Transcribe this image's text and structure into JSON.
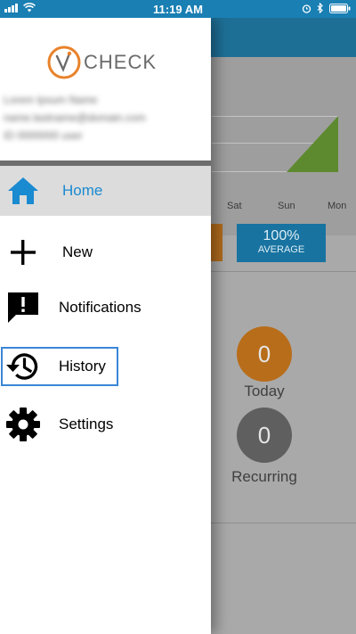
{
  "status_bar": {
    "time": "11:19 AM"
  },
  "brand": {
    "name": "CHECK",
    "accent": "#e8822a"
  },
  "user": {
    "name": "Lorem Ipsum Name",
    "email": "name.lastname@domain.com",
    "extra": "ID 0000000 user"
  },
  "menu": [
    {
      "label": "Home",
      "icon": "home-icon",
      "active": true
    },
    {
      "label": "New",
      "icon": "plus-icon",
      "active": false
    },
    {
      "label": "Notifications",
      "icon": "notifications-icon",
      "active": false
    },
    {
      "label": "History",
      "icon": "history-icon",
      "active": false
    },
    {
      "label": "Settings",
      "icon": "gear-icon",
      "active": false
    }
  ],
  "background": {
    "days": [
      "Sat",
      "Sun",
      "Mon"
    ],
    "average_value": "100%",
    "average_label": "AVERAGE",
    "today_count": "0",
    "today_label": "Today",
    "recurring_count": "0",
    "recurring_label": "Recurring"
  },
  "colors": {
    "accent_blue": "#1a8ad1",
    "status_bar": "#1a7fb3",
    "chart_green": "#5d8a2e",
    "today_orange": "#b86d1a",
    "recurring_gray": "#5f5f5f"
  }
}
